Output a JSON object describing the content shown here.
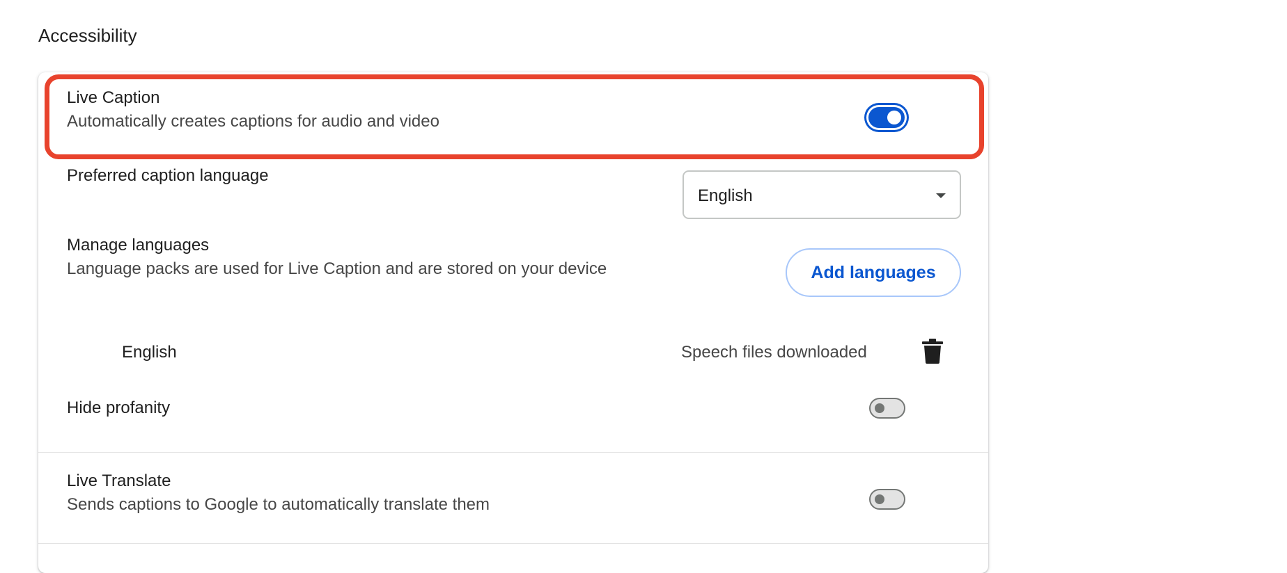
{
  "section": {
    "title": "Accessibility"
  },
  "live_caption": {
    "title": "Live Caption",
    "description": "Automatically creates captions for audio and video",
    "enabled": true
  },
  "caption_language": {
    "label": "Preferred caption language",
    "selected": "English"
  },
  "manage_languages": {
    "title": "Manage languages",
    "description": "Language packs are used for Live Caption and are stored on your device",
    "button_label": "Add languages",
    "languages": [
      {
        "name": "English",
        "status": "Speech files downloaded"
      }
    ]
  },
  "hide_profanity": {
    "title": "Hide profanity",
    "enabled": false
  },
  "live_translate": {
    "title": "Live Translate",
    "description": "Sends captions to Google to automatically translate them",
    "enabled": false
  },
  "colors": {
    "accent": "#0b57d0",
    "highlight": "#e8432d"
  }
}
